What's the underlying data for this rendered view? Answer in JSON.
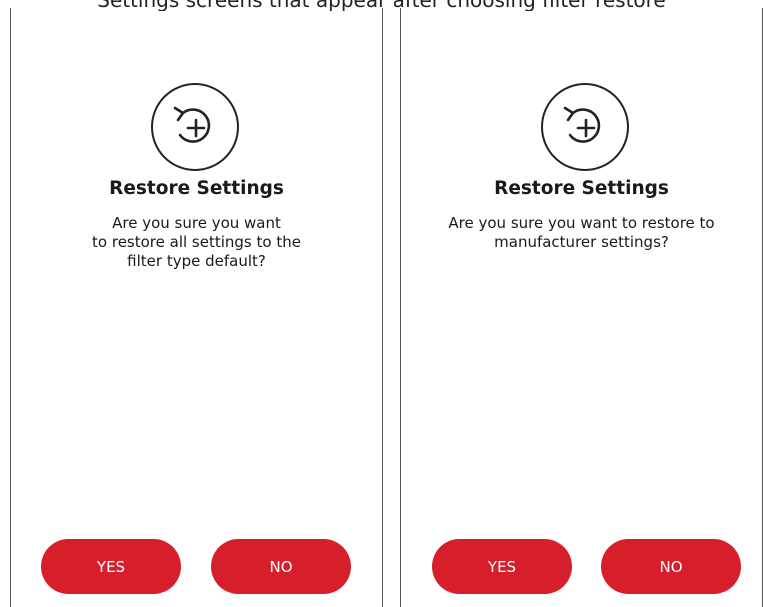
{
  "caption": "Settings screens that appear after choosing filter restore",
  "colors": {
    "accent": "#d71f2b",
    "text": "#1a1a1a",
    "border": "#555555"
  },
  "icon": "restore-plus-icon",
  "screens": [
    {
      "title": "Restore Settings",
      "message": "Are you sure you want\nto restore all settings to the\nfilter type default?",
      "yes_label": "YES",
      "no_label": "NO"
    },
    {
      "title": "Restore Settings",
      "message": "Are you sure you want to restore to\nmanufacturer settings?",
      "yes_label": "YES",
      "no_label": "NO"
    }
  ]
}
